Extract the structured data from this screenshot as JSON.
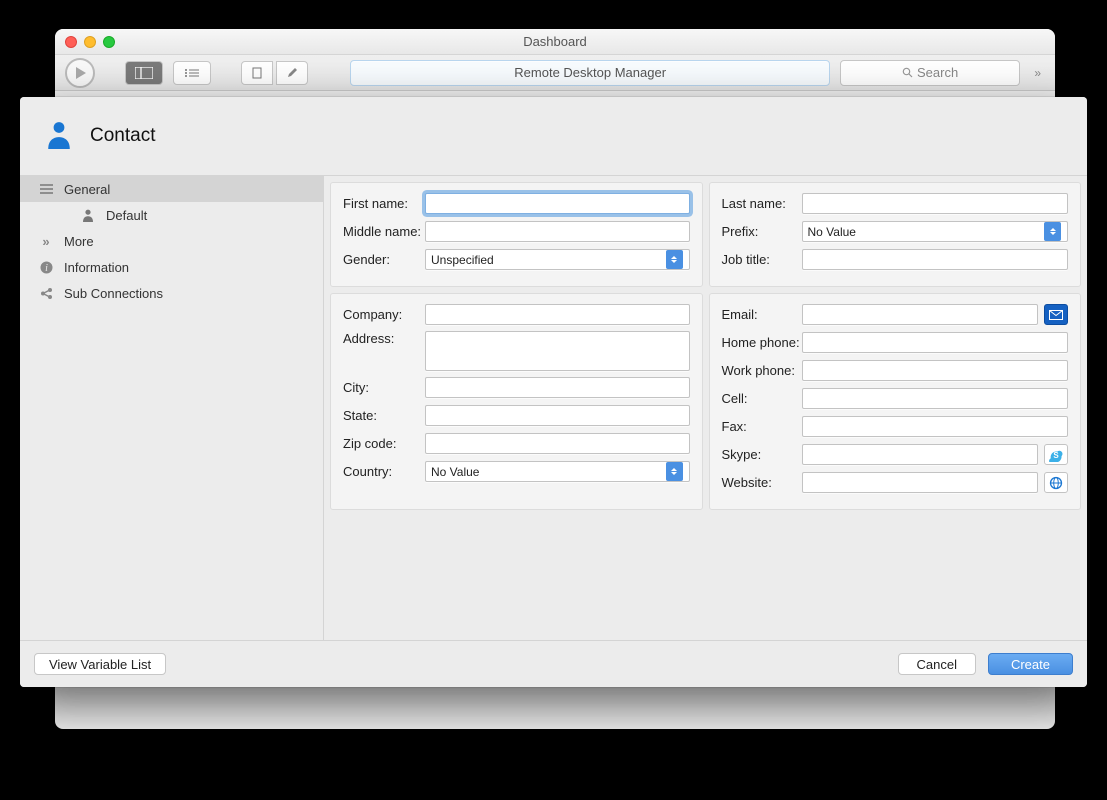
{
  "back_window": {
    "title": "Dashboard",
    "addressbar": "Remote Desktop Manager",
    "search_placeholder": "Search"
  },
  "modal": {
    "title": "Contact",
    "sidebar": {
      "general": "General",
      "default": "Default",
      "more": "More",
      "information": "Information",
      "sub_connections": "Sub Connections"
    },
    "labels": {
      "first_name": "First name:",
      "middle_name": "Middle name:",
      "gender": "Gender:",
      "last_name": "Last name:",
      "prefix": "Prefix:",
      "job_title": "Job title:",
      "company": "Company:",
      "address": "Address:",
      "city": "City:",
      "state": "State:",
      "zip": "Zip code:",
      "country": "Country:",
      "email": "Email:",
      "home_phone": "Home phone:",
      "work_phone": "Work phone:",
      "cell": "Cell:",
      "fax": "Fax:",
      "skype": "Skype:",
      "website": "Website:"
    },
    "values": {
      "first_name": "",
      "middle_name": "",
      "gender": "Unspecified",
      "last_name": "",
      "prefix": "No Value",
      "job_title": "",
      "company": "",
      "address": "",
      "city": "",
      "state": "",
      "zip": "",
      "country": "No Value",
      "email": "",
      "home_phone": "",
      "work_phone": "",
      "cell": "",
      "fax": "",
      "skype": "",
      "website": ""
    },
    "footer": {
      "view_var": "View Variable List",
      "cancel": "Cancel",
      "create": "Create"
    }
  }
}
